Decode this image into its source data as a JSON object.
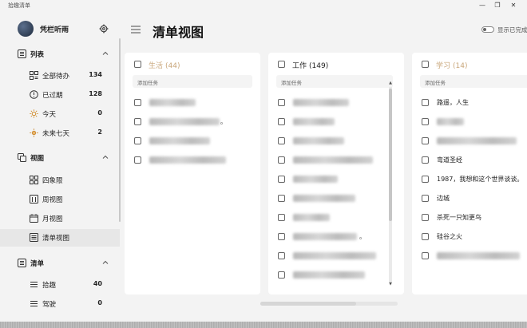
{
  "window": {
    "title": "拾趣清单",
    "minimize": "—",
    "maximize": "❐",
    "close": "✕"
  },
  "profile": {
    "username": "凭栏听雨"
  },
  "sidebar": {
    "sections": [
      {
        "label": "列表",
        "icon": "list-section-icon"
      },
      {
        "label": "视图",
        "icon": "views-section-icon"
      },
      {
        "label": "清单",
        "icon": "checklist-section-icon"
      }
    ],
    "list_items": [
      {
        "label": "全部待办",
        "count": "134",
        "icon": "all-todos-icon"
      },
      {
        "label": "已过期",
        "count": "128",
        "icon": "overdue-icon"
      },
      {
        "label": "今天",
        "count": "0",
        "icon": "today-sun-icon"
      },
      {
        "label": "未来七天",
        "count": "2",
        "icon": "next-seven-days-icon"
      }
    ],
    "view_items": [
      {
        "label": "四象限",
        "icon": "four-quadrant-icon"
      },
      {
        "label": "周视图",
        "icon": "week-view-icon"
      },
      {
        "label": "月视图",
        "icon": "month-view-icon"
      },
      {
        "label": "清单视图",
        "icon": "list-view-icon",
        "selected": true
      }
    ],
    "checklist_items": [
      {
        "label": "拾趣",
        "count": "40",
        "icon": "list-lines-icon"
      },
      {
        "label": "驾驶",
        "count": "0",
        "icon": "list-lines-icon"
      }
    ]
  },
  "header": {
    "title": "清单视图",
    "toggle_label": "显示已完成"
  },
  "columns": [
    {
      "title": "生活",
      "count": "(44)",
      "title_color": "#c9a77b",
      "add_placeholder": "添加任务",
      "tasks": [
        {
          "text": ""
        },
        {
          "text": "",
          "tail": "。"
        },
        {
          "text": ""
        },
        {
          "text": ""
        }
      ]
    },
    {
      "title": "工作",
      "count": "(149)",
      "title_color": "#222222",
      "add_placeholder": "添加任务",
      "tasks": [
        {
          "text": ""
        },
        {
          "text": ""
        },
        {
          "text": ""
        },
        {
          "text": ""
        },
        {
          "text": ""
        },
        {
          "text": ""
        },
        {
          "text": ""
        },
        {
          "text": "",
          "tail": "。"
        },
        {
          "text": ""
        },
        {
          "text": ""
        }
      ]
    },
    {
      "title": "学习",
      "count": "(14)",
      "title_color": "#c9a77b",
      "add_placeholder": "添加任务",
      "tasks": [
        {
          "text": "路遥，人生"
        },
        {
          "text": ""
        },
        {
          "text": ""
        },
        {
          "text": "弯道圣经"
        },
        {
          "text": "1987，我想和这个世界谈谈。"
        },
        {
          "text": "边城"
        },
        {
          "text": "杀死一只知更鸟"
        },
        {
          "text": "硅谷之火"
        },
        {
          "text": ""
        }
      ]
    }
  ],
  "colors": {
    "accent_muted": "#c9a77b",
    "selected_bg": "#e7e7e7",
    "panel_bg": "#ffffff",
    "app_bg": "#f3f3f3"
  }
}
